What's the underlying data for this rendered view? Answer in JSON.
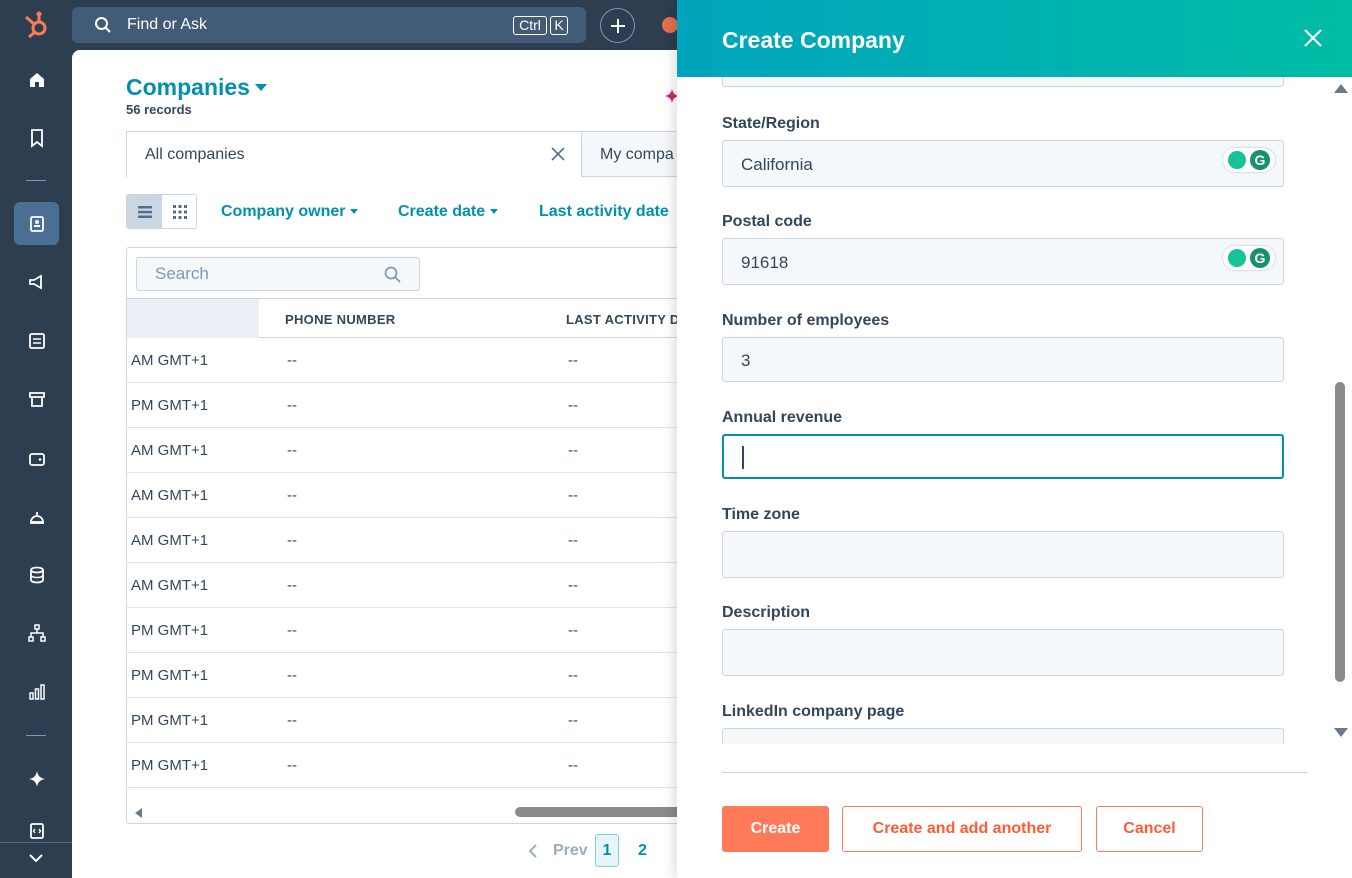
{
  "topbar": {
    "search_text": "Find or Ask",
    "shortcut_ctrl": "Ctrl",
    "shortcut_key": "K"
  },
  "page": {
    "title": "Companies",
    "record_count": "56 records"
  },
  "views": {
    "tab1": "All companies",
    "tab2": "My compa"
  },
  "filters": {
    "owner": "Company owner",
    "create_date": "Create date",
    "last_activity": "Last activity date"
  },
  "table": {
    "search_placeholder": "Search",
    "headers": {
      "phone": "PHONE NUMBER",
      "last_activity": "LAST ACTIVITY D"
    },
    "rows": [
      {
        "time": "AM GMT+1",
        "phone": "--",
        "activity": "--"
      },
      {
        "time": "PM GMT+1",
        "phone": "--",
        "activity": "--"
      },
      {
        "time": "AM GMT+1",
        "phone": "--",
        "activity": "--"
      },
      {
        "time": "AM GMT+1",
        "phone": "--",
        "activity": "--"
      },
      {
        "time": "AM GMT+1",
        "phone": "--",
        "activity": "--"
      },
      {
        "time": "AM GMT+1",
        "phone": "--",
        "activity": "--"
      },
      {
        "time": "PM GMT+1",
        "phone": "--",
        "activity": "--"
      },
      {
        "time": "PM GMT+1",
        "phone": "--",
        "activity": "--"
      },
      {
        "time": "PM GMT+1",
        "phone": "--",
        "activity": "--"
      },
      {
        "time": "PM GMT+1",
        "phone": "--",
        "activity": "--"
      }
    ]
  },
  "pagination": {
    "prev": "Prev",
    "page1": "1",
    "page2": "2"
  },
  "panel": {
    "title": "Create Company",
    "fields": {
      "state": {
        "label": "State/Region",
        "value": "California"
      },
      "postal": {
        "label": "Postal code",
        "value": "91618"
      },
      "employees": {
        "label": "Number of employees",
        "value": "3"
      },
      "revenue": {
        "label": "Annual revenue",
        "value": ""
      },
      "timezone": {
        "label": "Time zone",
        "value": ""
      },
      "description": {
        "label": "Description",
        "value": ""
      },
      "linkedin": {
        "label": "LinkedIn company page",
        "value": ""
      }
    },
    "buttons": {
      "create": "Create",
      "create_another": "Create and add another",
      "cancel": "Cancel"
    }
  },
  "colors": {
    "brand_teal": "#0091ae",
    "header_gradient_start": "#00a4bd",
    "header_gradient_end": "#00bda5",
    "primary_orange": "#ff7a59",
    "nav_bg": "#2d3e50"
  },
  "icons": {
    "nav": [
      "home-icon",
      "bookmark-icon",
      "contacts-icon",
      "marketing-icon",
      "content-icon",
      "commerce-icon",
      "payments-icon",
      "service-icon",
      "data-icon",
      "automation-icon",
      "reporting-icon",
      "sparkle-icon",
      "dev-icon"
    ]
  }
}
